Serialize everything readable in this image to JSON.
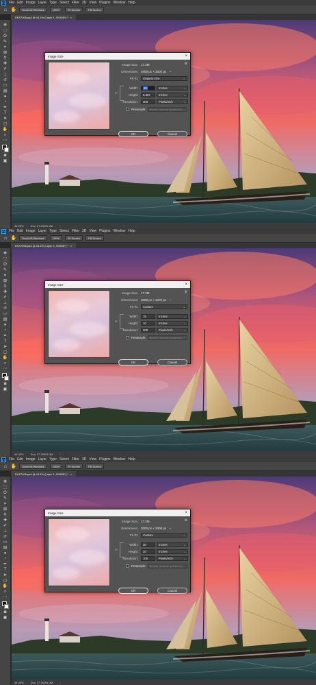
{
  "menu": [
    "File",
    "Edit",
    "Image",
    "Layer",
    "Type",
    "Select",
    "Filter",
    "3D",
    "View",
    "Plugins",
    "Window",
    "Help"
  ],
  "app_icon": "Ps",
  "options": {
    "scroll_all": "Scroll All Windows",
    "zoom": "100%",
    "fit_screen": "Fit Screen",
    "fill_screen": "Fill Screen"
  },
  "document_tab": "EKS7206.psd @ 44.1% (Layer 1, RGB/8*) *",
  "status": {
    "zoom": "44.05%",
    "doc": "Doc: 27.2M/54.3M"
  },
  "dialog": {
    "title": "Image Size",
    "image_size_label": "Image Size:",
    "image_size_value": "17.2M",
    "dimensions_label": "Dimensions:",
    "dimensions_value": "3000 px  ×  2000 px",
    "fit_to_label": "Fit To:",
    "width_label": "Width:",
    "height_label": "Height:",
    "resolution_label": "Resolution:",
    "resample_label": "Resample:",
    "resample_value": "Bicubic (smooth gradients)",
    "unit_inches": "Inches",
    "unit_ppi": "Pixels/Inch",
    "ok": "OK",
    "cancel": "Cancel"
  },
  "panels": [
    {
      "fit_to": "Original Size",
      "width": "10",
      "height": "6.667",
      "resolution": "300",
      "width_selected": true
    },
    {
      "fit_to": "Custom",
      "width": "15",
      "height": "10",
      "resolution": "200",
      "width_selected": false
    },
    {
      "fit_to": "Custom",
      "width": "30",
      "height": "20",
      "resolution": "100",
      "width_selected": false
    }
  ]
}
